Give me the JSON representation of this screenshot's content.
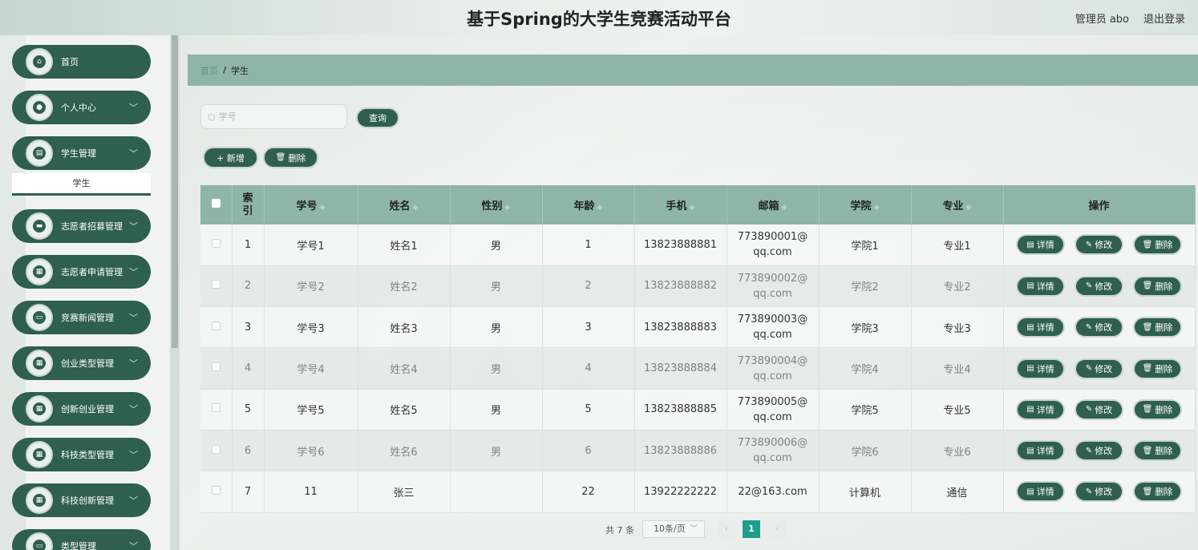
{
  "header": {
    "title": "基于Spring的大学生竞赛活动平台",
    "user": "管理员 abo",
    "logout": "退出登录"
  },
  "sidebar": {
    "items": [
      {
        "label": "首页",
        "icon": "home-icon",
        "glyph": "⌂",
        "chevron": false
      },
      {
        "label": "个人中心",
        "icon": "user-icon",
        "glyph": "●",
        "chevron": true
      },
      {
        "label": "学生管理",
        "icon": "chart-icon",
        "glyph": "▤",
        "chevron": true
      },
      {
        "label": "志愿者招募管理",
        "icon": "message-icon",
        "glyph": "▬",
        "chevron": true
      },
      {
        "label": "志愿者申请管理",
        "icon": "grid-icon",
        "glyph": "▦",
        "chevron": true
      },
      {
        "label": "竞赛新闻管理",
        "icon": "monitor-icon",
        "glyph": "▭",
        "chevron": true
      },
      {
        "label": "创业类型管理",
        "icon": "grid-icon",
        "glyph": "▦",
        "chevron": true
      },
      {
        "label": "创新创业管理",
        "icon": "grid-icon",
        "glyph": "▦",
        "chevron": true
      },
      {
        "label": "科技类型管理",
        "icon": "grid-icon",
        "glyph": "▦",
        "chevron": true
      },
      {
        "label": "科技创新管理",
        "icon": "grid-icon",
        "glyph": "▦",
        "chevron": true
      },
      {
        "label": "类型管理",
        "icon": "monitor-icon",
        "glyph": "▭",
        "chevron": true
      }
    ],
    "sub_item": "学生"
  },
  "breadcrumb": {
    "home": "首页",
    "separator": "/",
    "current": "学生"
  },
  "search": {
    "placeholder": "学号",
    "button": "查询"
  },
  "actions": {
    "add": "+ 新增",
    "delete": "删除"
  },
  "table": {
    "headers": [
      "索引",
      "学号",
      "姓名",
      "性别",
      "年龄",
      "手机",
      "邮箱",
      "学院",
      "专业",
      "操作"
    ],
    "rows": [
      {
        "index": "1",
        "student_no": "学号1",
        "name": "姓名1",
        "gender": "男",
        "age": "1",
        "phone": "13823888881",
        "email": "773890001@qq.com",
        "college": "学院1",
        "major": "专业1"
      },
      {
        "index": "2",
        "student_no": "学号2",
        "name": "姓名2",
        "gender": "男",
        "age": "2",
        "phone": "13823888882",
        "email": "773890002@qq.com",
        "college": "学院2",
        "major": "专业2"
      },
      {
        "index": "3",
        "student_no": "学号3",
        "name": "姓名3",
        "gender": "男",
        "age": "3",
        "phone": "13823888883",
        "email": "773890003@qq.com",
        "college": "学院3",
        "major": "专业3"
      },
      {
        "index": "4",
        "student_no": "学号4",
        "name": "姓名4",
        "gender": "男",
        "age": "4",
        "phone": "13823888884",
        "email": "773890004@qq.com",
        "college": "学院4",
        "major": "专业4"
      },
      {
        "index": "5",
        "student_no": "学号5",
        "name": "姓名5",
        "gender": "男",
        "age": "5",
        "phone": "13823888885",
        "email": "773890005@qq.com",
        "college": "学院5",
        "major": "专业5"
      },
      {
        "index": "6",
        "student_no": "学号6",
        "name": "姓名6",
        "gender": "男",
        "age": "6",
        "phone": "13823888886",
        "email": "773890006@qq.com",
        "college": "学院6",
        "major": "专业6"
      },
      {
        "index": "7",
        "student_no": "11",
        "name": "张三",
        "gender": "",
        "age": "22",
        "phone": "13922222222",
        "email": "22@163.com",
        "college": "计算机",
        "major": "通信"
      }
    ],
    "row_actions": {
      "detail": "详情",
      "edit": "修改",
      "delete": "删除"
    }
  },
  "pagination": {
    "total": "共 7 条",
    "page_size": "10条/页",
    "current_page": "1",
    "prev": "‹",
    "next": "›"
  },
  "colors": {
    "primary": "#2f5f4e",
    "header_bg": "#8fb5a8",
    "active_page": "#1e9f8c"
  }
}
